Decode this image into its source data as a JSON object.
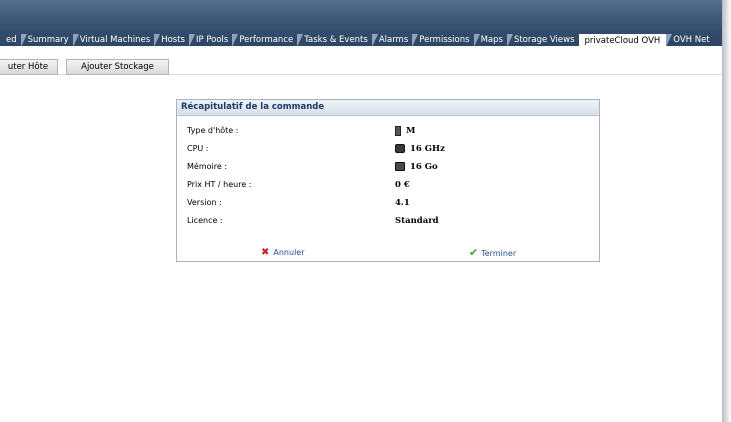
{
  "tabs": [
    {
      "label": "ed",
      "active": false
    },
    {
      "label": "Summary",
      "active": false
    },
    {
      "label": "Virtual Machines",
      "active": false
    },
    {
      "label": "Hosts",
      "active": false
    },
    {
      "label": "IP Pools",
      "active": false
    },
    {
      "label": "Performance",
      "active": false
    },
    {
      "label": "Tasks & Events",
      "active": false
    },
    {
      "label": "Alarms",
      "active": false
    },
    {
      "label": "Permissions",
      "active": false
    },
    {
      "label": "Maps",
      "active": false
    },
    {
      "label": "Storage Views",
      "active": false
    },
    {
      "label": "privateCloud OVH",
      "active": true
    },
    {
      "label": "OVH Net",
      "active": false
    }
  ],
  "toolbar": {
    "add_host_label": "uter Hôte",
    "add_storage_label": "Ajouter Stockage"
  },
  "summary": {
    "title": "Récapitulatif de la commande",
    "rows": [
      {
        "label": "Type d'hôte :",
        "value": "M",
        "icon": "server-icon"
      },
      {
        "label": "CPU :",
        "value": "16 GHz",
        "icon": "cpu-icon"
      },
      {
        "label": "Mémoire :",
        "value": "16 Go",
        "icon": "memory-icon"
      },
      {
        "label": "Prix HT / heure :",
        "value": "0 €",
        "icon": ""
      },
      {
        "label": "Version :",
        "value": "4.1",
        "icon": ""
      },
      {
        "label": "Licence :",
        "value": "Standard",
        "icon": ""
      }
    ],
    "cancel_label": "Annuler",
    "finish_label": "Terminer"
  },
  "colors": {
    "header": "#3f5878",
    "tab_inactive": "#8ea3bc",
    "panel_title_text": "#1c3b66",
    "link": "#1f4f8e",
    "cancel_icon": "#d02020",
    "finish_icon": "#3aa33a"
  }
}
